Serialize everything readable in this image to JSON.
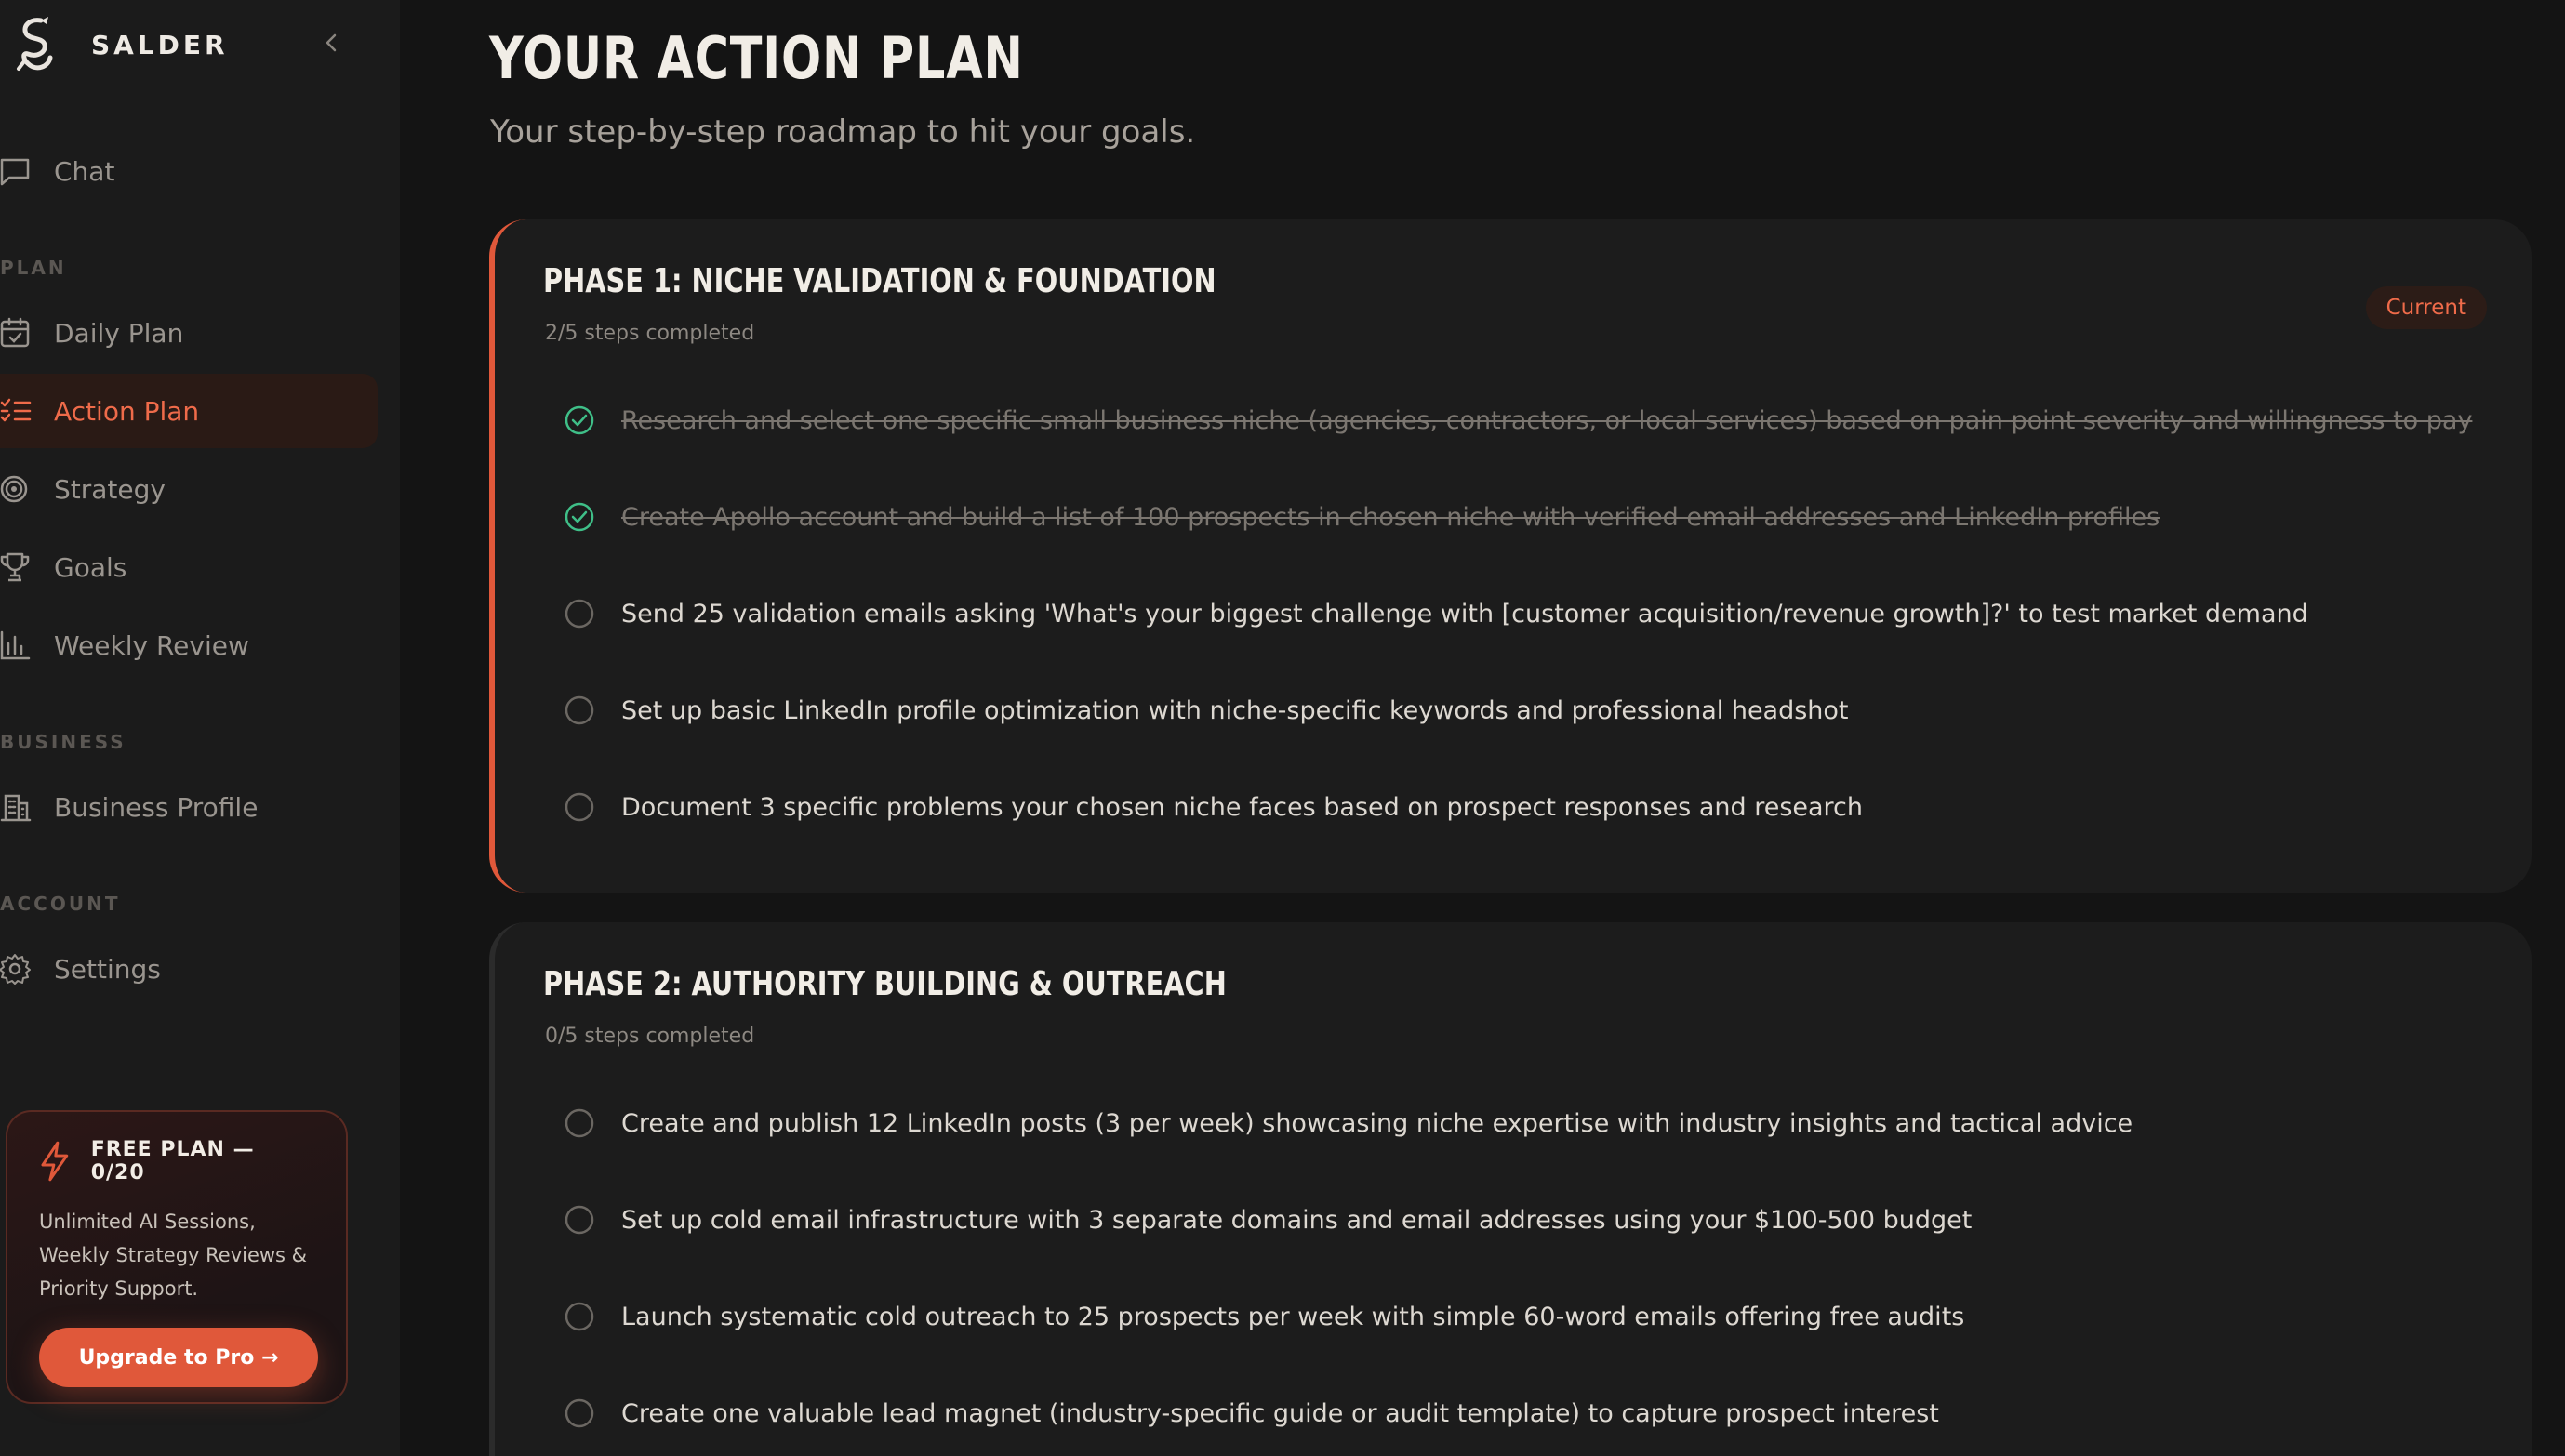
{
  "app": {
    "name": "SALDER"
  },
  "sidebar": {
    "nav_chat": "Chat",
    "section_plan": "PLAN",
    "plan_items": [
      {
        "label": "Daily Plan",
        "icon": "calendar-icon"
      },
      {
        "label": "Action Plan",
        "icon": "checklist-icon",
        "active": true
      },
      {
        "label": "Strategy",
        "icon": "target-icon"
      },
      {
        "label": "Goals",
        "icon": "trophy-icon"
      },
      {
        "label": "Weekly Review",
        "icon": "bar-chart-icon"
      }
    ],
    "section_business": "BUSINESS",
    "business_profile": "Business Profile",
    "section_account": "ACCOUNT",
    "settings": "Settings",
    "promo": {
      "title": "FREE PLAN — 0/20",
      "description": "Unlimited AI Sessions, Weekly Strategy Reviews & Priority Support.",
      "button": "Upgrade to Pro →"
    }
  },
  "main": {
    "title": "YOUR ACTION PLAN",
    "subtitle": "Your step-by-step roadmap to hit your goals.",
    "phases": [
      {
        "title": "PHASE 1: NICHE VALIDATION & FOUNDATION",
        "progress": "2/5 steps completed",
        "badge": "Current",
        "steps": [
          {
            "text": "Research and select one specific small business niche (agencies, contractors, or local services) based on pain point severity and willingness to pay",
            "done": true
          },
          {
            "text": "Create Apollo account and build a list of 100 prospects in chosen niche with verified email addresses and LinkedIn profiles",
            "done": true
          },
          {
            "text": "Send 25 validation emails asking 'What's your biggest challenge with [customer acquisition/revenue growth]?' to test market demand",
            "done": false
          },
          {
            "text": "Set up basic LinkedIn profile optimization with niche-specific keywords and professional headshot",
            "done": false
          },
          {
            "text": "Document 3 specific problems your chosen niche faces based on prospect responses and research",
            "done": false
          }
        ]
      },
      {
        "title": "PHASE 2: AUTHORITY BUILDING & OUTREACH",
        "progress": "0/5 steps completed",
        "steps": [
          {
            "text": "Create and publish 12 LinkedIn posts (3 per week) showcasing niche expertise with industry insights and tactical advice",
            "done": false
          },
          {
            "text": "Set up cold email infrastructure with 3 separate domains and email addresses using your $100-500 budget",
            "done": false
          },
          {
            "text": "Launch systematic cold outreach to 25 prospects per week with simple 60-word emails offering free audits",
            "done": false
          },
          {
            "text": "Create one valuable lead magnet (industry-specific guide or audit template) to capture prospect interest",
            "done": false
          }
        ]
      }
    ]
  },
  "colors": {
    "accent": "#e0583a",
    "done_check": "#3fbf88",
    "background": "#141414",
    "sidebar": "#1b1b1b"
  }
}
